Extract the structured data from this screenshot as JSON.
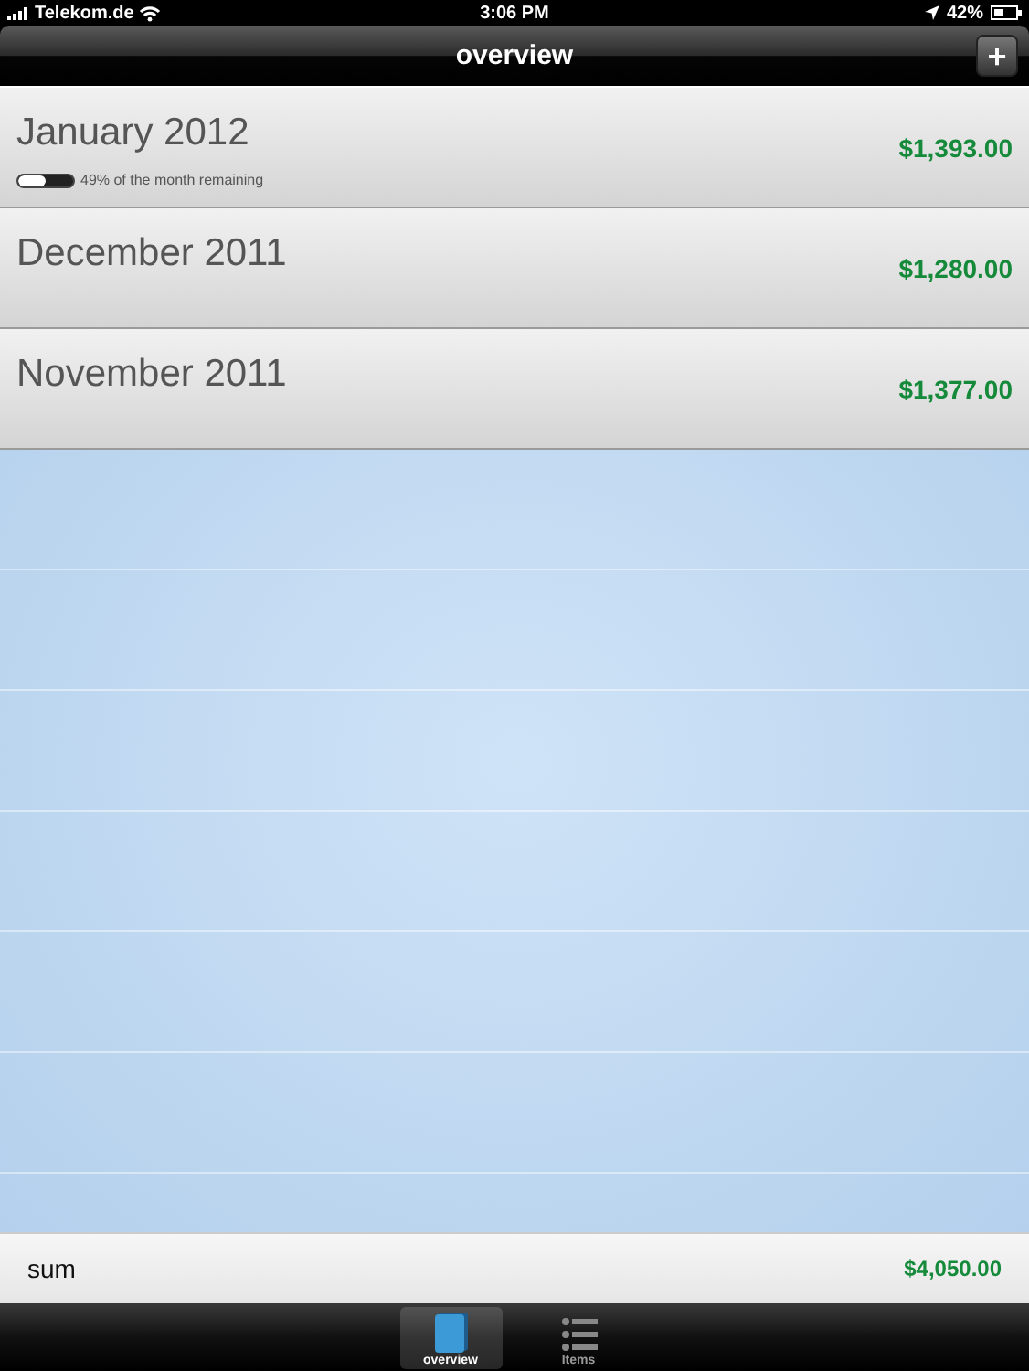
{
  "status_bar": {
    "carrier": "Telekom.de",
    "time": "3:06 PM",
    "battery": "42%"
  },
  "nav_bar": {
    "title": "overview",
    "add_button": "+"
  },
  "months": [
    {
      "name": "January 2012",
      "amount": "$1,393.00",
      "progress": {
        "level": 0.49,
        "label": "49% of the month remaining"
      }
    },
    {
      "name": "December 2011",
      "amount": "$1,280.00"
    },
    {
      "name": "November 2011",
      "amount": "$1,377.00"
    }
  ],
  "sum": {
    "label": "sum",
    "amount": "$4,050.00"
  },
  "tabs": [
    {
      "label": "overview",
      "kind": "book",
      "selected": true
    },
    {
      "label": "Items",
      "kind": "list",
      "selected": false
    }
  ]
}
